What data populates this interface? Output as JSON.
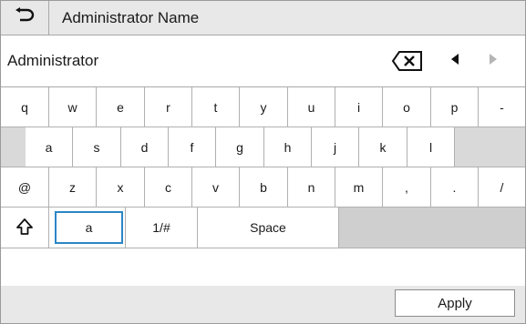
{
  "header": {
    "title": "Administrator Name",
    "back_icon": "back-arrow-icon"
  },
  "input": {
    "value": "Administrator",
    "backspace_icon": "backspace-icon",
    "cursor_left_icon": "triangle-left-icon",
    "cursor_right_icon": "triangle-right-icon"
  },
  "keyboard": {
    "row1": [
      "q",
      "w",
      "e",
      "r",
      "t",
      "y",
      "u",
      "i",
      "o",
      "p",
      "-"
    ],
    "row2": [
      "a",
      "s",
      "d",
      "f",
      "g",
      "h",
      "j",
      "k",
      "l"
    ],
    "row3": [
      "@",
      "z",
      "x",
      "c",
      "v",
      "b",
      "n",
      "m",
      ",",
      ".",
      "/"
    ],
    "shift_icon": "shift-arrow-icon",
    "mode_lower": "a",
    "mode_symbols": "1/#",
    "space": "Space"
  },
  "footer": {
    "apply_label": "Apply"
  },
  "colors": {
    "accent": "#2b86c5",
    "header_bg": "#e8e8e8",
    "key_bg": "#ffffff",
    "spacer_bg": "#d9d9d9"
  }
}
